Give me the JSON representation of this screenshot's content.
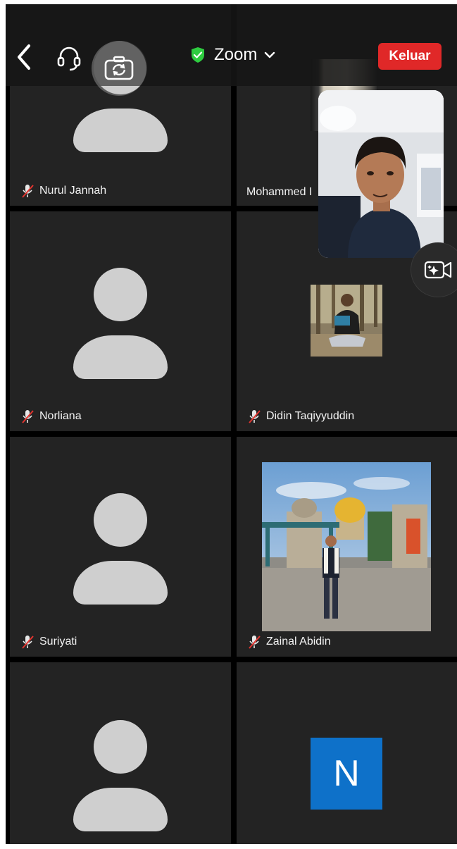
{
  "meeting": {
    "title": "Zoom",
    "leave_label": "Keluar"
  },
  "participants": [
    {
      "name": "Nurul Jannah",
      "muted": true
    },
    {
      "name": "Mohammed I",
      "muted": false
    },
    {
      "name": "Norliana",
      "muted": true
    },
    {
      "name": "Didin Taqiyyuddin",
      "muted": true
    },
    {
      "name": "Suriyati",
      "muted": true
    },
    {
      "name": "Zainal Abidin",
      "muted": true
    },
    {
      "name": "",
      "muted": false
    },
    {
      "name": "",
      "initial": "N"
    }
  ],
  "icons": {
    "back": "chevron-left-icon",
    "audio": "headset-icon",
    "camera_switch": "camera-switch-icon",
    "encryption": "shield-check-icon",
    "dropdown": "chevron-down-icon",
    "effects": "video-effects-icon",
    "muted": "mic-off-icon"
  },
  "colors": {
    "leave": "#e02828",
    "shield": "#2ecc40",
    "avatar_n": "#0e71c9",
    "tile": "#232323"
  }
}
